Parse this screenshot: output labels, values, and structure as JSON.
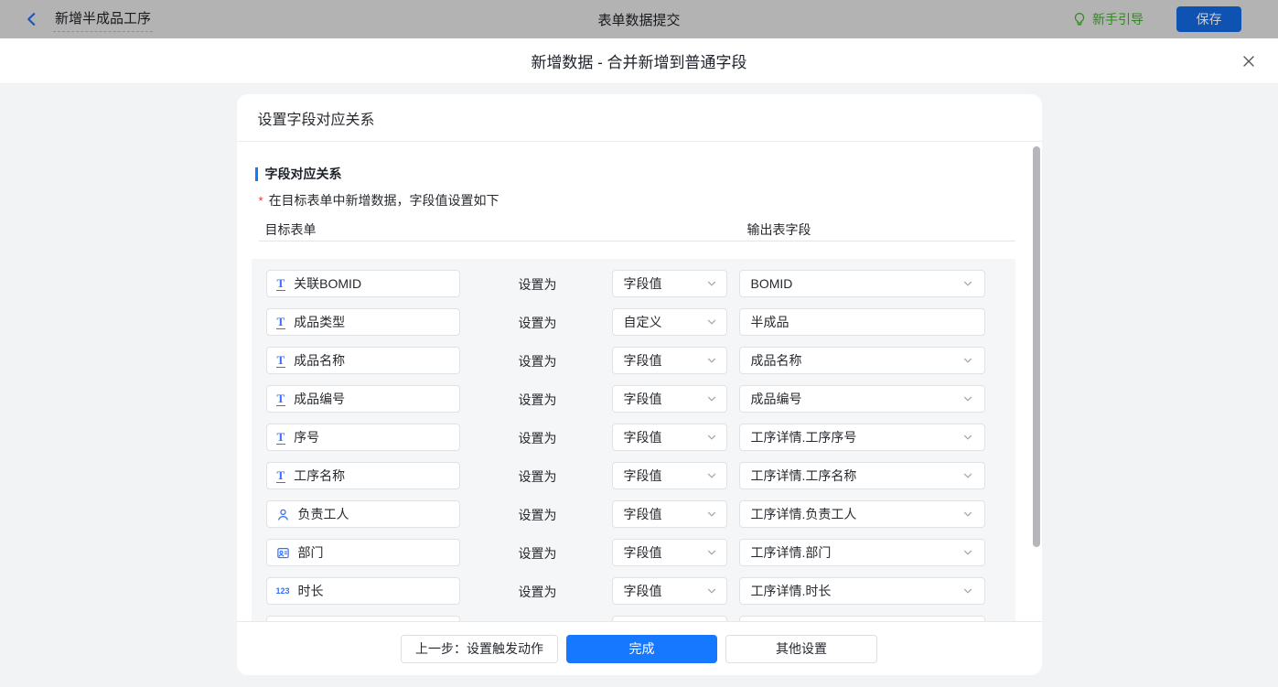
{
  "topbar": {
    "back_label": "新增半成品工序",
    "center_title": "表单数据提交",
    "guide_label": "新手引导",
    "save_label": "保存"
  },
  "modal": {
    "title": "新增数据 - 合并新增到普通字段",
    "card_title": "设置字段对应关系",
    "section_title": "字段对应关系",
    "required_mark": "*",
    "section_desc": "在目标表单中新增数据，字段值设置如下",
    "columns": {
      "target": "目标表单",
      "output": "输出表字段"
    },
    "set_as_label": "设置为",
    "rows": [
      {
        "field_icon": "text",
        "target": "关联BOMID",
        "mode": "字段值",
        "output": "BOMID",
        "output_type": "select"
      },
      {
        "field_icon": "text",
        "target": "成品类型",
        "mode": "自定义",
        "output": "半成品",
        "output_type": "input"
      },
      {
        "field_icon": "text",
        "target": "成品名称",
        "mode": "字段值",
        "output": "成品名称",
        "output_type": "select"
      },
      {
        "field_icon": "text",
        "target": "成品编号",
        "mode": "字段值",
        "output": "成品编号",
        "output_type": "select"
      },
      {
        "field_icon": "text",
        "target": "序号",
        "mode": "字段值",
        "output": "工序详情.工序序号",
        "output_type": "select"
      },
      {
        "field_icon": "text",
        "target": "工序名称",
        "mode": "字段值",
        "output": "工序详情.工序名称",
        "output_type": "select"
      },
      {
        "field_icon": "user",
        "target": "负责工人",
        "mode": "字段值",
        "output": "工序详情.负责工人",
        "output_type": "select"
      },
      {
        "field_icon": "department",
        "target": "部门",
        "mode": "字段值",
        "output": "工序详情.部门",
        "output_type": "select"
      },
      {
        "field_icon": "number",
        "target": "时长",
        "mode": "字段值",
        "output": "工序详情.时长",
        "output_type": "select"
      }
    ],
    "footer": {
      "prev_label": "上一步：设置触发动作",
      "done_label": "完成",
      "other_label": "其他设置"
    }
  },
  "colors": {
    "primary_blue": "#1677ff",
    "field_icon_blue": "#3370ff",
    "guide_green": "#2e8a1e",
    "dimmed_topbar_bg": "#b3b3b3"
  }
}
